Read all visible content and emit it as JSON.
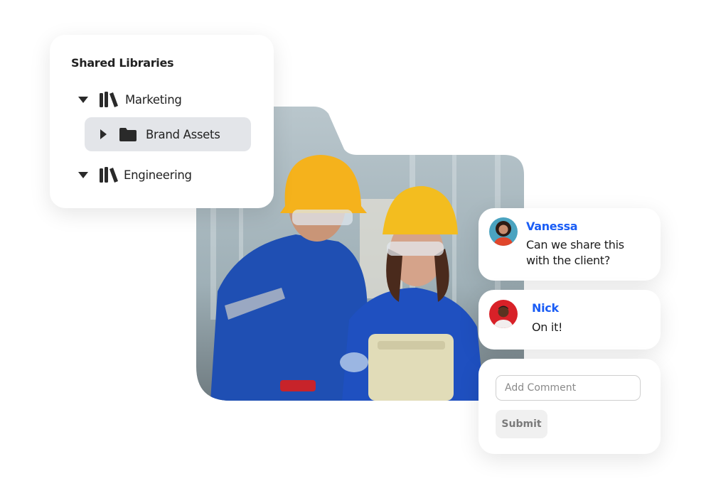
{
  "library_panel": {
    "title": "Shared Libraries",
    "items": [
      {
        "label": "Marketing",
        "icon": "library-books-icon",
        "expanded": true,
        "level": 0
      },
      {
        "label": "Brand Assets",
        "icon": "folder-icon",
        "expanded": false,
        "level": 1,
        "selected": true
      },
      {
        "label": "Engineering",
        "icon": "library-books-icon",
        "expanded": true,
        "level": 0
      }
    ]
  },
  "photo": {
    "description": "Two workers in blue coveralls and yellow hard hats smiling at a device in a factory",
    "shape": "folder"
  },
  "comments": [
    {
      "author": "Vanessa",
      "text_line1": "Can we share this",
      "text_line2": "with the client?"
    },
    {
      "author": "Nick",
      "text_line1": "On it!"
    }
  ],
  "comment_form": {
    "placeholder": "Add Comment",
    "value": "",
    "submit_label": "Submit"
  },
  "colors": {
    "accent": "#1a5df5",
    "selected_bg": "#e3e5e9",
    "text": "#222222"
  }
}
